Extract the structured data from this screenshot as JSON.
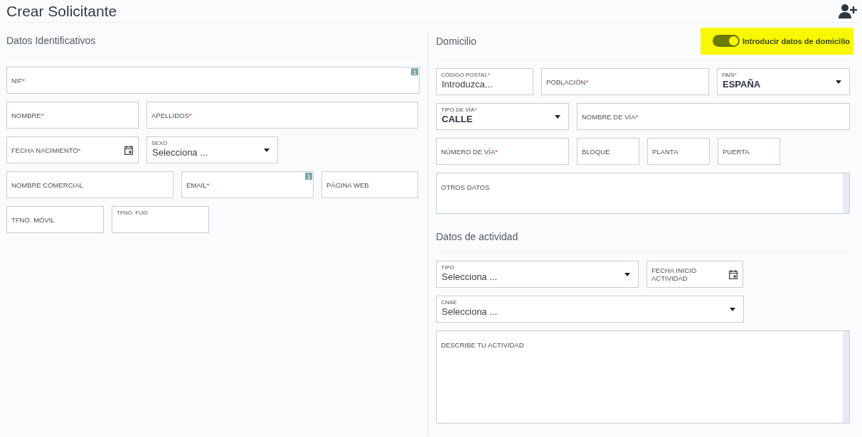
{
  "title": "Crear Solicitante",
  "left": {
    "heading": "Datos Identificativos",
    "rows": [
      {
        "fields": [
          {
            "kind": "text",
            "label": "NIF",
            "mark": "*",
            "info": true
          }
        ]
      },
      {
        "fields": [
          {
            "kind": "text",
            "label": "NOMBRE",
            "mark": "*"
          },
          {
            "kind": "text",
            "label": "APELLIDOS",
            "mark": "*"
          }
        ]
      },
      {
        "fields": [
          {
            "kind": "date",
            "label": "FECHA NACIMIENTO",
            "mark": "*"
          },
          {
            "kind": "select",
            "label": "SEXO",
            "value": "Selecciona ..."
          }
        ]
      },
      {
        "fields": [
          {
            "kind": "text",
            "label": "NOMBRE COMERCIAL"
          },
          {
            "kind": "text",
            "label": "EMAIL",
            "mark": "*",
            "info": true
          },
          {
            "kind": "text",
            "label": "PÁGINA WEB"
          }
        ]
      },
      {
        "fields": [
          {
            "kind": "text",
            "label": "TFNO. MÓVIL"
          },
          {
            "kind": "float",
            "label": "TFNO. FIJO"
          }
        ]
      }
    ]
  },
  "domicilio": {
    "heading": "Domicilio",
    "toggle": {
      "label": "Introducir datos de domicilio",
      "on": true
    },
    "rows": [
      {
        "fields": [
          {
            "kind": "float",
            "label": "CÓDIGO POSTAL",
            "mark": "*",
            "placeholder": "Introduzca..."
          },
          {
            "kind": "text",
            "label": "POBLACIÓN",
            "mark": "*"
          },
          {
            "kind": "select",
            "label": "PAÍS",
            "mark": "*",
            "value": "ESPAÑA",
            "bold": true
          }
        ]
      },
      {
        "fields": [
          {
            "kind": "select",
            "label": "TIPO DE VÍA",
            "mark": "*",
            "value": "CALLE",
            "bold": true
          },
          {
            "kind": "text",
            "label": "NOMBRE DE VÍA",
            "mark": "*"
          }
        ]
      },
      {
        "fields": [
          {
            "kind": "text",
            "label": "NÚMERO DE VÍA",
            "mark": "*"
          },
          {
            "kind": "text",
            "label": "BLOQUE"
          },
          {
            "kind": "text",
            "label": "PLANTA"
          },
          {
            "kind": "text",
            "label": "PUERTA"
          }
        ]
      },
      {
        "fields": [
          {
            "kind": "textarea",
            "label": "OTROS DATOS"
          }
        ]
      }
    ]
  },
  "actividad": {
    "heading": "Datos de actividad",
    "rows": [
      {
        "fields": [
          {
            "kind": "select",
            "label": "TIPO",
            "value": "Selecciona ..."
          },
          {
            "kind": "date",
            "label": "FECHA INICIO ACTIVIDAD"
          }
        ]
      },
      {
        "fields": [
          {
            "kind": "select",
            "label": "CNAE",
            "value": "Selecciona ..."
          }
        ]
      },
      {
        "fields": [
          {
            "kind": "textarea",
            "label": "DESCRIBE TU ACTIVIDAD",
            "tall": true
          }
        ]
      }
    ]
  }
}
